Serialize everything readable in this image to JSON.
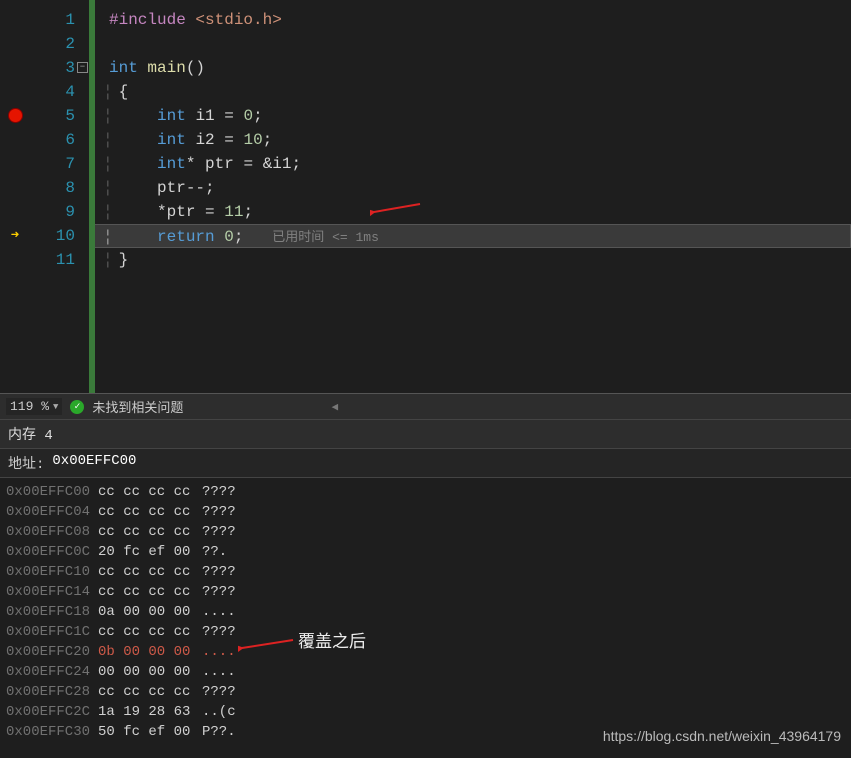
{
  "editor": {
    "line_count": 11,
    "breakpoint_line": 5,
    "current_exec_line": 10,
    "fold_at_line": 3,
    "timing_hint": "已用时间 <= 1ms",
    "lines": {
      "l1_include": "#include",
      "l1_header": "<stdio.h>",
      "l3_kw": "int",
      "l3_fn": "main",
      "l3_paren": "()",
      "l4_brace": "{",
      "l5_kw": "int",
      "l5_id": "i1",
      "l5_eq": "=",
      "l5_num": "0",
      "l5_semi": ";",
      "l6_kw": "int",
      "l6_id": "i2",
      "l6_eq": "=",
      "l6_num": "10",
      "l6_semi": ";",
      "l7_kw": "int",
      "l7_ptr": "*",
      "l7_id": "ptr",
      "l7_eq": "=",
      "l7_amp": "&",
      "l7_id2": "i1",
      "l7_semi": ";",
      "l8_id": "ptr",
      "l8_op": "--",
      "l8_semi": ";",
      "l9_star": "*",
      "l9_id": "ptr",
      "l9_eq": "=",
      "l9_num": "11",
      "l9_semi": ";",
      "l10_kw": "return",
      "l10_num": "0",
      "l10_semi": ";",
      "l11_brace": "}"
    }
  },
  "status": {
    "zoom": "119 %",
    "issues": "未找到相关问题"
  },
  "memory": {
    "panel_title": "内存 4",
    "address_label": "地址:",
    "address_value": "0x00EFFC00",
    "rows": [
      {
        "addr": "0x00EFFC00",
        "hex": "cc cc cc cc",
        "asc": "????"
      },
      {
        "addr": "0x00EFFC04",
        "hex": "cc cc cc cc",
        "asc": "????"
      },
      {
        "addr": "0x00EFFC08",
        "hex": "cc cc cc cc",
        "asc": "????"
      },
      {
        "addr": "0x00EFFC0C",
        "hex": "20 fc ef 00",
        "asc": " ??."
      },
      {
        "addr": "0x00EFFC10",
        "hex": "cc cc cc cc",
        "asc": "????"
      },
      {
        "addr": "0x00EFFC14",
        "hex": "cc cc cc cc",
        "asc": "????"
      },
      {
        "addr": "0x00EFFC18",
        "hex": "0a 00 00 00",
        "asc": "...."
      },
      {
        "addr": "0x00EFFC1C",
        "hex": "cc cc cc cc",
        "asc": "????"
      },
      {
        "addr": "0x00EFFC20",
        "hex": "0b 00 00 00",
        "asc": "....",
        "highlight": true
      },
      {
        "addr": "0x00EFFC24",
        "hex": "00 00 00 00",
        "asc": "...."
      },
      {
        "addr": "0x00EFFC28",
        "hex": "cc cc cc cc",
        "asc": "????"
      },
      {
        "addr": "0x00EFFC2C",
        "hex": "1a 19 28 63",
        "asc": "..(c"
      },
      {
        "addr": "0x00EFFC30",
        "hex": "50 fc ef 00",
        "asc": "P??."
      }
    ],
    "annotation": "覆盖之后"
  },
  "watermark": "https://blog.csdn.net/weixin_43964179"
}
